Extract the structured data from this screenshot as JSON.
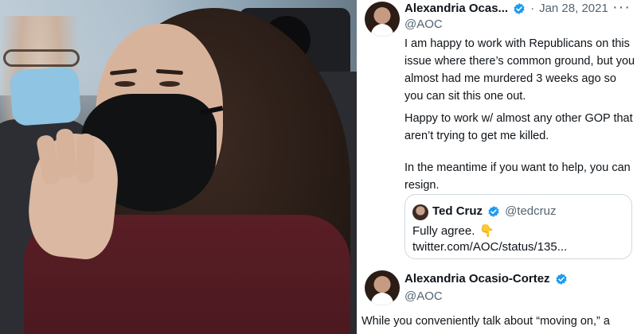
{
  "tweet1": {
    "display_name": "Alexandria Ocas...",
    "dot": "·",
    "date": "Jan 28, 2021",
    "more": "···",
    "handle": "@AOC",
    "paragraphs": [
      "I am happy to work with Republicans on this issue where there’s common ground, but you almost had me murdered 3 weeks ago so you can sit this one out.",
      "Happy to work w/ almost any other GOP that aren’t trying to get me killed.",
      "In the meantime if you want to help, you can resign."
    ],
    "quote": {
      "display_name": "Ted Cruz",
      "handle": "@tedcruz",
      "text": "Fully agree.",
      "emoji": "👇",
      "link": "twitter.com/AOC/status/135..."
    }
  },
  "tweet2": {
    "display_name": "Alexandria Ocasio-Cortez",
    "handle": "@AOC",
    "text_cut": "While you conveniently talk about “moving on,” a"
  },
  "colors": {
    "verified_blue": "#1d9bf0",
    "muted_text": "#536471",
    "primary_text": "#0f1419",
    "coat_maroon": "#5a1e25",
    "mask_black": "#111214"
  },
  "icons": [
    "verified-icon",
    "more-icon",
    "pointing-down-emoji"
  ]
}
